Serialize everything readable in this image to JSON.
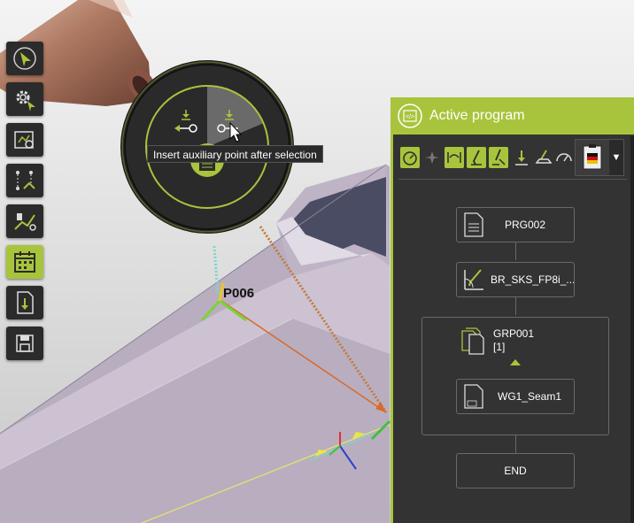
{
  "viewport": {
    "point_label": "P006"
  },
  "radial_menu": {
    "tooltip": "Insert auxiliary point after selection"
  },
  "left_toolbar": {
    "buttons": [
      "select",
      "settings",
      "program",
      "path",
      "points",
      "schedule",
      "document",
      "save"
    ],
    "active": "schedule"
  },
  "program_panel": {
    "title": "Active program",
    "nodes": {
      "program": "PRG002",
      "tool": "BR_SKS_FP8i_...",
      "group": "GRP001",
      "group_count": "[1]",
      "seam": "WG1_Seam1",
      "end": "END"
    }
  },
  "colors": {
    "accent": "#a8c43c",
    "panel_bg": "#333333"
  }
}
